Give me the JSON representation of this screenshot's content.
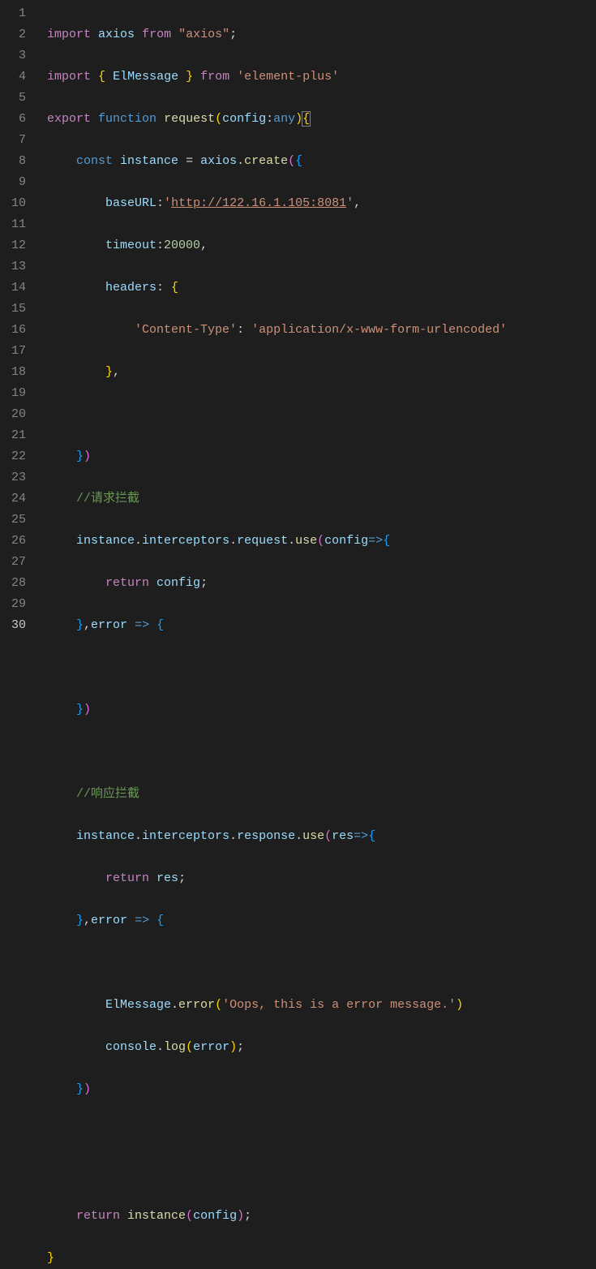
{
  "lineCount": 30,
  "activeLine": 30,
  "code": {
    "l1": {
      "a": "import",
      "b": "axios",
      "c": "from",
      "d": "\"axios\""
    },
    "l2": {
      "a": "import",
      "b": "ElMessage",
      "c": "from",
      "d": "'element-plus'"
    },
    "l3": {
      "a": "export",
      "b": "function",
      "c": "request",
      "d": "config",
      "e": "any"
    },
    "l4": {
      "a": "const",
      "b": "instance",
      "c": "axios",
      "d": "create"
    },
    "l5": {
      "a": "baseURL",
      "b": "'",
      "c": "http://122.16.1.105:8081",
      "d": "'"
    },
    "l6": {
      "a": "timeout",
      "b": "20000"
    },
    "l7": {
      "a": "headers"
    },
    "l8": {
      "a": "'Content-Type'",
      "b": "'application/x-www-form-urlencoded'"
    },
    "l12": {
      "a": "//请求拦截"
    },
    "l13": {
      "a": "instance",
      "b": "interceptors",
      "c": "request",
      "d": "use",
      "e": "config"
    },
    "l14": {
      "a": "return",
      "b": "config"
    },
    "l15": {
      "a": "error"
    },
    "l19": {
      "a": "//响应拦截"
    },
    "l20": {
      "a": "instance",
      "b": "interceptors",
      "c": "response",
      "d": "use",
      "e": "res"
    },
    "l21": {
      "a": "return",
      "b": "res"
    },
    "l22": {
      "a": "error"
    },
    "l24": {
      "a": "ElMessage",
      "b": "error",
      "c": "'Oops, this is a error message.'"
    },
    "l25": {
      "a": "console",
      "b": "log",
      "c": "error"
    },
    "l29": {
      "a": "return",
      "b": "instance",
      "c": "config"
    }
  }
}
